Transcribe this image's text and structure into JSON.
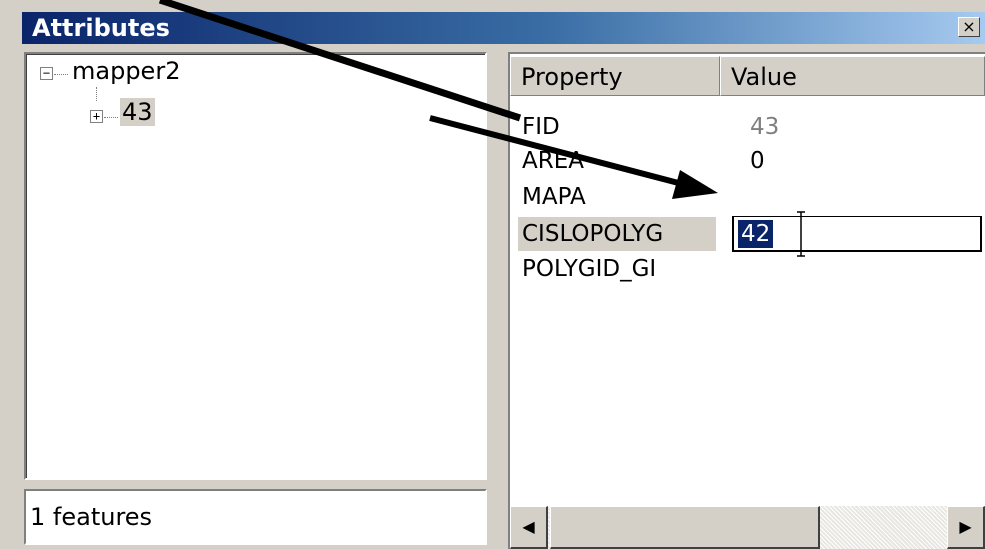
{
  "window": {
    "title": "Attributes",
    "close_glyph": "×"
  },
  "tree": {
    "root": {
      "expander": "−",
      "label": "mapper2"
    },
    "child": {
      "expander": "+",
      "label": "43"
    }
  },
  "status": {
    "text": "1 features"
  },
  "grid": {
    "headers": {
      "property": "Property",
      "value": "Value"
    },
    "rows": [
      {
        "name": "FID",
        "value": "43"
      },
      {
        "name": "AREA",
        "value": "0"
      },
      {
        "name": "MAPA",
        "value": ""
      },
      {
        "name": "CISLOPOLYG",
        "value": "42"
      },
      {
        "name": "POLYGID_GI",
        "value": ""
      }
    ]
  },
  "scrollbar": {
    "left_glyph": "◀",
    "right_glyph": "▶"
  },
  "colors": {
    "titlebar_start": "#0a246a",
    "titlebar_end": "#a6caf0",
    "selection": "#0a246a",
    "face": "#d4d0c8"
  }
}
